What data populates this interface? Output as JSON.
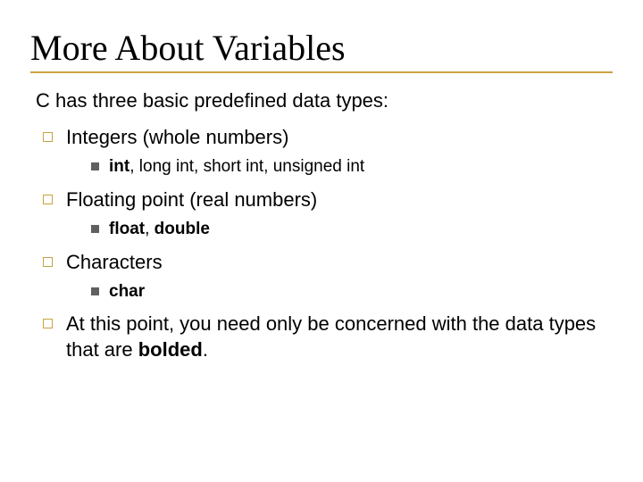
{
  "title": "More About Variables",
  "intro": "C has three basic predefined data types:",
  "items": [
    {
      "label": "Integers (whole numbers)",
      "sub": {
        "parts": [
          {
            "t": "int",
            "b": true
          },
          {
            "t": ", long int, short int, unsigned int",
            "b": false
          }
        ]
      }
    },
    {
      "label": "Floating point (real numbers)",
      "sub": {
        "parts": [
          {
            "t": "float",
            "b": true
          },
          {
            "t": ", ",
            "b": false
          },
          {
            "t": "double",
            "b": true
          }
        ]
      }
    },
    {
      "label": "Characters",
      "sub": {
        "parts": [
          {
            "t": "char",
            "b": true
          }
        ]
      }
    },
    {
      "paragraph": {
        "parts": [
          {
            "t": "At this point, you need only be concerned with the data types that are ",
            "b": false
          },
          {
            "t": "bolded",
            "b": true
          },
          {
            "t": ".",
            "b": false
          }
        ]
      }
    }
  ]
}
